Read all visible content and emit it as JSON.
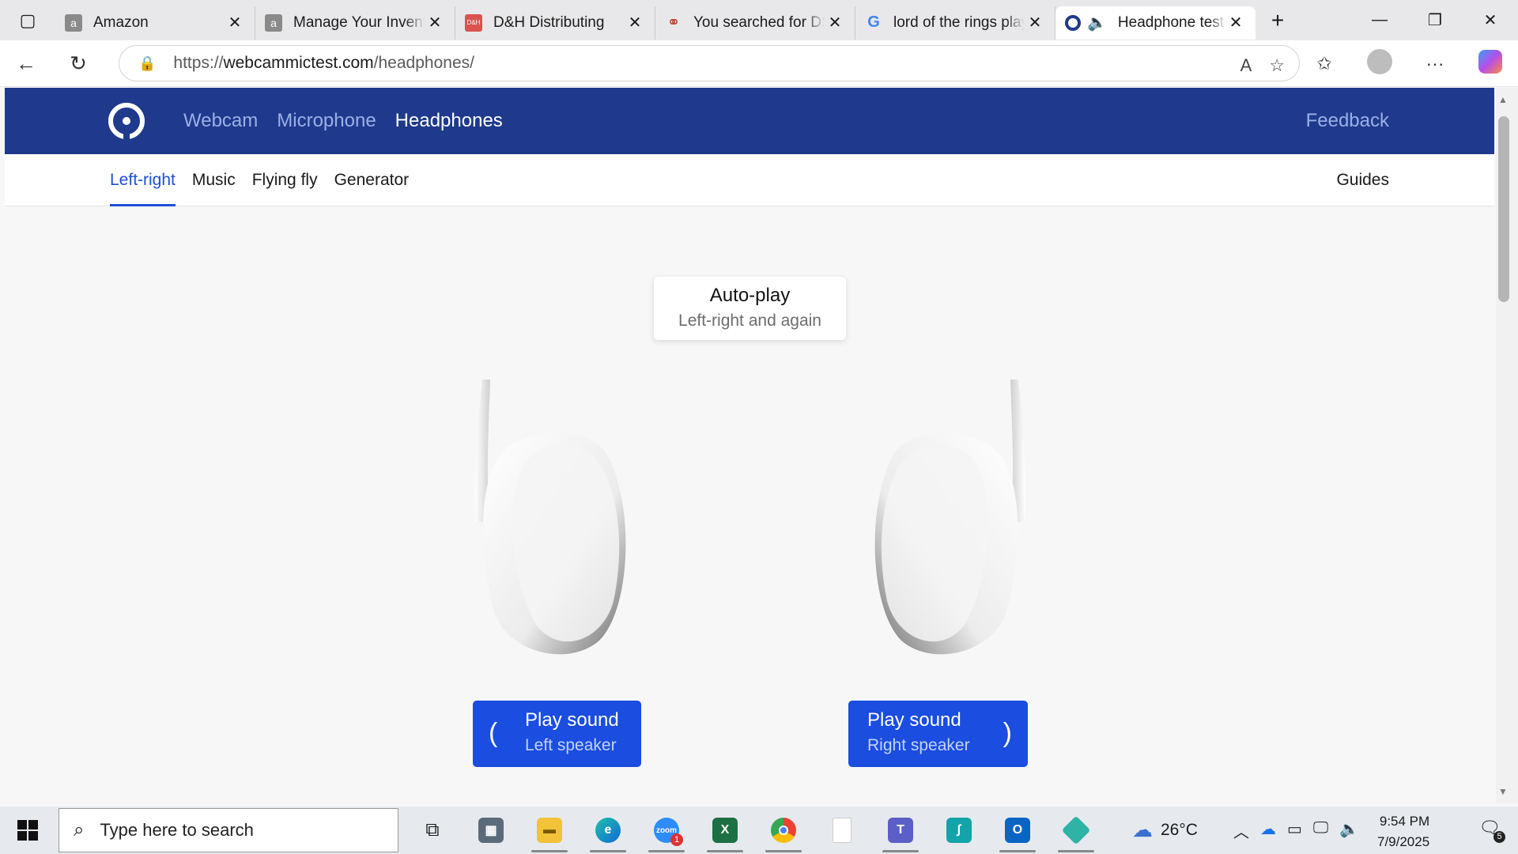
{
  "browser": {
    "tabs": [
      {
        "title": "Amazon",
        "icon": "amazon-icon",
        "color": "#9e9e9e"
      },
      {
        "title": "Manage Your Inventory",
        "icon": "amazon-icon",
        "color": "#9e9e9e"
      },
      {
        "title": "D&H Distributing",
        "icon": "dh-icon",
        "color": "#d9534f"
      },
      {
        "title": "You searched for DS",
        "icon": "search-site-icon",
        "color": "#c0392b"
      },
      {
        "title": "lord of the rings play",
        "icon": "google-icon",
        "color": "#4285f4"
      },
      {
        "title": "Headphone test",
        "icon": "webcammictest-icon",
        "color": "#1f3a8c",
        "active": true,
        "audio": true
      }
    ],
    "url_prefix": "https://",
    "url_host": "webcammictest.com",
    "url_path": "/headphones/"
  },
  "site": {
    "nav": [
      "Webcam",
      "Microphone",
      "Headphones"
    ],
    "current_nav": "Headphones",
    "feedback": "Feedback",
    "subnav": [
      "Left-right",
      "Music",
      "Flying fly",
      "Generator"
    ],
    "current_subnav": "Left-right",
    "guides": "Guides",
    "brand_color": "#1f3a8c",
    "accent_color": "#1a4de0"
  },
  "autoplay": {
    "title": "Auto-play",
    "subtitle": "Left-right and again"
  },
  "left_button": {
    "line1": "Play sound",
    "line2": "Left speaker"
  },
  "right_button": {
    "line1": "Play sound",
    "line2": "Right speaker"
  },
  "taskbar": {
    "search_placeholder": "Type here to search",
    "apps": [
      "task-view-icon",
      "calculator-icon",
      "file-explorer-icon",
      "edge-icon",
      "zoom-icon",
      "excel-icon",
      "chrome-icon",
      "notepad-icon",
      "teams-icon",
      "sigma-icon",
      "outlook-icon",
      "app-icon"
    ],
    "zoom_badge": "1",
    "weather": "26°C",
    "time": "9:54 PM",
    "date": "7/9/2025",
    "notifications": "5"
  }
}
